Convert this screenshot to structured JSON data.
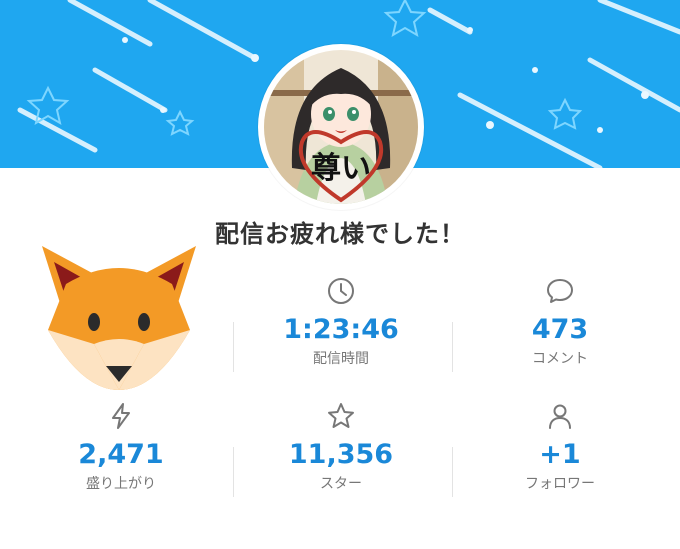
{
  "colors": {
    "banner": "#1fa7f0",
    "value": "#1a88d8",
    "label": "#777777",
    "title": "#333333"
  },
  "header": {
    "title": "配信お疲れ様でした！"
  },
  "avatar": {
    "badge_text": "尊い"
  },
  "stats": [
    {
      "icon": "lightning-icon",
      "value": "",
      "label": ""
    },
    {
      "icon": "clock-icon",
      "value": "1:23:46",
      "label": "配信時間"
    },
    {
      "icon": "comment-icon",
      "value": "473",
      "label": "コメント"
    },
    {
      "icon": "lightning-icon",
      "value": "2,471",
      "label": "盛り上がり"
    },
    {
      "icon": "star-icon",
      "value": "11,356",
      "label": "スター"
    },
    {
      "icon": "person-icon",
      "value": "+1",
      "label": "フォロワー"
    }
  ],
  "overlay": {
    "icon": "fox-icon"
  }
}
